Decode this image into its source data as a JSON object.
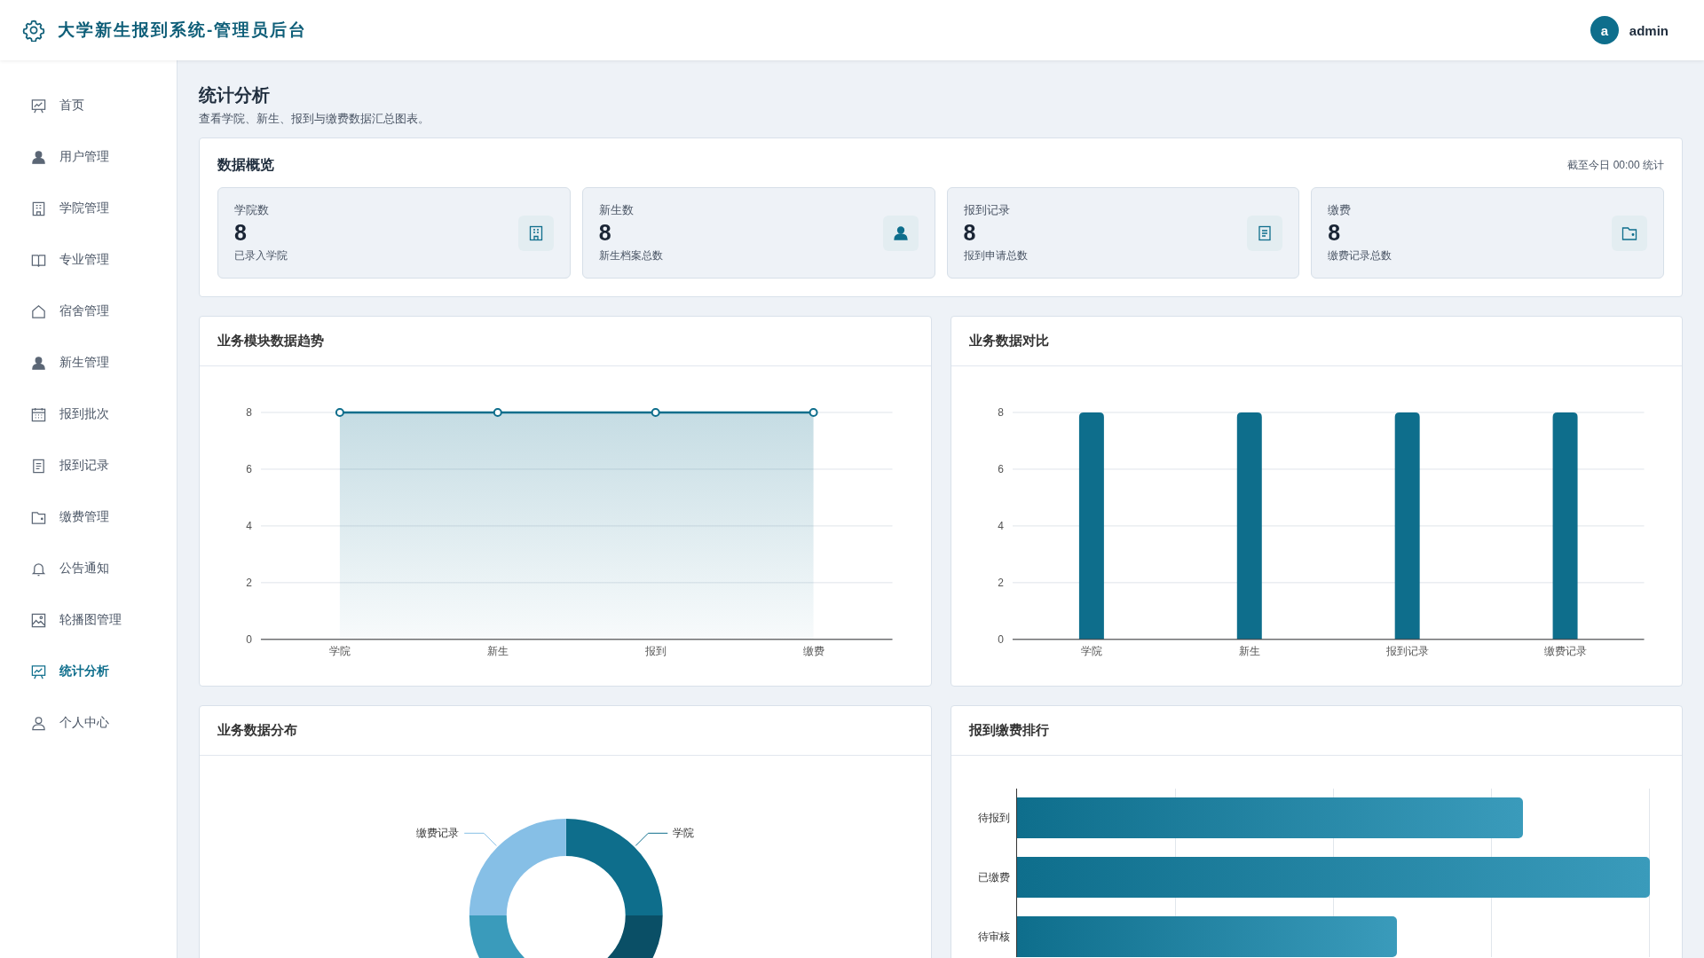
{
  "header": {
    "title": "大学新生报到系统-管理员后台",
    "user": {
      "avatar": "a",
      "name": "admin"
    }
  },
  "sidebar": {
    "items": [
      {
        "label": "首页",
        "selected": false
      },
      {
        "label": "用户管理",
        "selected": false
      },
      {
        "label": "学院管理",
        "selected": false
      },
      {
        "label": "专业管理",
        "selected": false
      },
      {
        "label": "宿舍管理",
        "selected": false
      },
      {
        "label": "新生管理",
        "selected": false
      },
      {
        "label": "报到批次",
        "selected": false
      },
      {
        "label": "报到记录",
        "selected": false
      },
      {
        "label": "缴费管理",
        "selected": false
      },
      {
        "label": "公告通知",
        "selected": false
      },
      {
        "label": "轮播图管理",
        "selected": false
      },
      {
        "label": "统计分析",
        "selected": true
      },
      {
        "label": "个人中心",
        "selected": false
      }
    ]
  },
  "page": {
    "title": "统计分析",
    "subtitle": "查看学院、新生、报到与缴费数据汇总图表。"
  },
  "overview": {
    "title": "数据概览",
    "note": "截至今日 00:00 统计",
    "cards": [
      {
        "label": "学院数",
        "value": "8",
        "caption": "已录入学院"
      },
      {
        "label": "新生数",
        "value": "8",
        "caption": "新生档案总数"
      },
      {
        "label": "报到记录",
        "value": "8",
        "caption": "报到申请总数"
      },
      {
        "label": "缴费",
        "value": "8",
        "caption": "缴费记录总数"
      }
    ]
  },
  "trend": {
    "title": "业务模块数据趋势",
    "chart_data": {
      "type": "area",
      "categories": [
        "学院",
        "新生",
        "报到",
        "缴费"
      ],
      "values": [
        8,
        8,
        8,
        8
      ],
      "ylim": [
        0,
        8
      ],
      "yticks": [
        0,
        2,
        4,
        6,
        8
      ],
      "grid": true
    }
  },
  "compare": {
    "title": "业务数据对比",
    "chart_data": {
      "type": "bar",
      "categories": [
        "学院",
        "新生",
        "报到记录",
        "缴费记录"
      ],
      "values": [
        8,
        8,
        8,
        8
      ],
      "ylim": [
        0,
        8
      ],
      "yticks": [
        0,
        2,
        4,
        6,
        8
      ],
      "grid": true
    }
  },
  "distribution": {
    "title": "业务数据分布",
    "chart_data": {
      "type": "donut",
      "categories": [
        "学院",
        null,
        null,
        "缴费记录"
      ],
      "values": [
        25,
        25,
        25,
        25
      ]
    }
  },
  "ranking": {
    "title": "报到缴费排行",
    "items": [
      {
        "label": "待报到",
        "level": 0.8
      },
      {
        "label": "已缴费",
        "level": 1
      },
      {
        "label": "待审核",
        "level": 0.6
      }
    ]
  }
}
